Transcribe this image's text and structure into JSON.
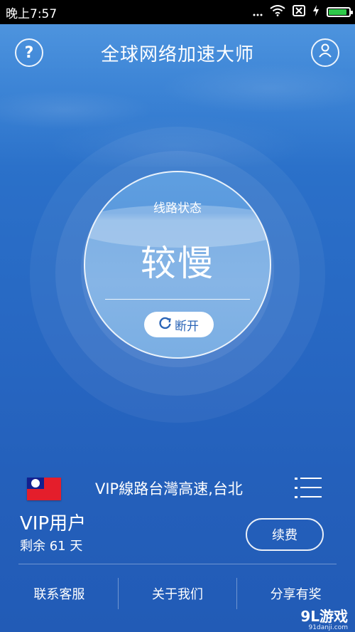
{
  "status_bar": {
    "time": "晚上7:57",
    "icons": [
      "signal-dots-icon",
      "wifi-icon",
      "sim-x-icon",
      "charging-icon",
      "battery-icon"
    ],
    "battery_level": 0.9,
    "battery_color": "#2ec94a"
  },
  "header": {
    "title": "全球网络加速大师",
    "help_icon": "?",
    "user_icon": "user-icon"
  },
  "status_panel": {
    "label": "线路状态",
    "value": "较慢",
    "button_label": "断开",
    "button_icon": "refresh-icon"
  },
  "server": {
    "flag": "taiwan-flag-icon",
    "name": "VIP線路台灣高速,台北"
  },
  "vip": {
    "title": "VIP用户",
    "remaining": "剩余 61 天",
    "renew_label": "续费"
  },
  "bottom_nav": [
    {
      "label": "联系客服"
    },
    {
      "label": "关于我们"
    },
    {
      "label": "分享有奖"
    }
  ],
  "watermark": {
    "main": "9L游戏",
    "sub": "91danji.com"
  },
  "colors": {
    "background": "#2a6fc8",
    "accent_text": "#2a64b6"
  }
}
